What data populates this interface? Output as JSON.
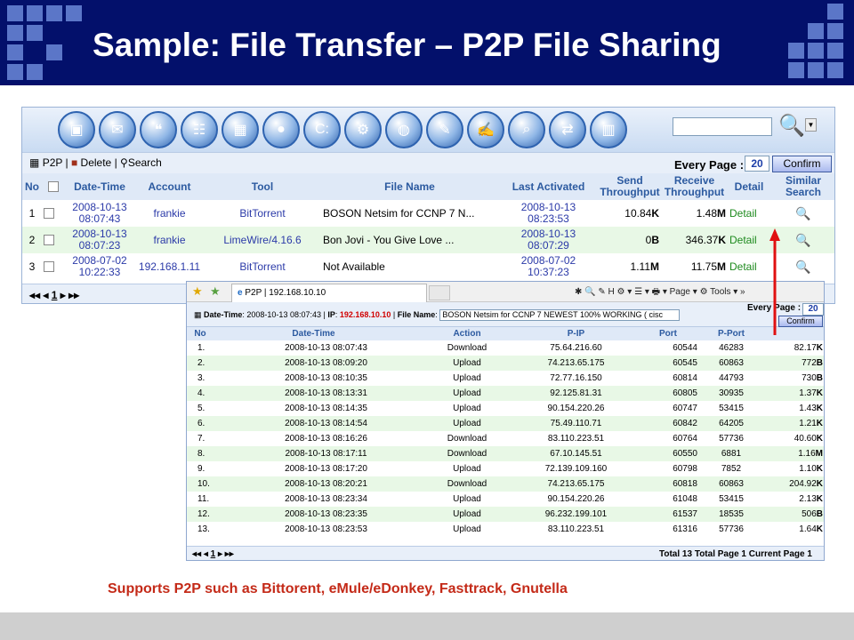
{
  "slide": {
    "title": "Sample: File Transfer – P2P File Sharing",
    "caption": "Supports P2P such as Bittorent, eMule/eDonkey, Fasttrack, Gnutella",
    "colors": {
      "header_bg": "#03106b",
      "caption": "#c42a18",
      "arrow": "#e01010"
    }
  },
  "main": {
    "toolbar_icons": [
      "server-icon",
      "mail-icon",
      "chat-icon",
      "web-icon",
      "box-icon",
      "p2p-icon",
      "terminal-icon",
      "gear-icon",
      "globe-icon",
      "tools-icon",
      "notes-icon",
      "search-folder-icon",
      "transfer-icon",
      "chart-icon"
    ],
    "actions": {
      "p2p": "P2P",
      "delete": "Delete",
      "search": "Search"
    },
    "every_page_label": "Every Page :",
    "every_page_value": "20",
    "confirm": "Confirm",
    "columns": [
      "No",
      "Date-Time",
      "Account",
      "Tool",
      "File Name",
      "Last Activated",
      "Send Throughput",
      "Receive Throughput",
      "Detail",
      "Similar Search"
    ],
    "rows": [
      {
        "no": "1",
        "date": "2008-10-13",
        "time": "08:07:43",
        "account": "frankie",
        "tool": "BitTorrent",
        "file": "BOSON Netsim for CCNP 7 N...",
        "last_date": "2008-10-13",
        "last_time": "08:23:53",
        "send_val": "10.84",
        "send_unit": "K",
        "recv_val": "1.48",
        "recv_unit": "M",
        "detail": "Detail"
      },
      {
        "no": "2",
        "date": "2008-10-13",
        "time": "08:07:23",
        "account": "frankie",
        "tool": "LimeWire/4.16.6",
        "file": "Bon Jovi - You Give Love ...",
        "last_date": "2008-10-13",
        "last_time": "08:07:29",
        "send_val": "0",
        "send_unit": "B",
        "recv_val": "346.37",
        "recv_unit": "K",
        "detail": "Detail"
      },
      {
        "no": "3",
        "date": "2008-07-02",
        "time": "10:22:33",
        "account": "192.168.1.11",
        "tool": "BitTorrent",
        "file": "Not Available",
        "last_date": "2008-07-02",
        "last_time": "10:37:23",
        "send_val": "1.11",
        "send_unit": "M",
        "recv_val": "11.75",
        "recv_unit": "M",
        "detail": "Detail"
      }
    ],
    "pager": "◂◂ ◂ 1 ▸ ▸▸",
    "pager_page": "1"
  },
  "detail": {
    "tab_title": "P2P | 192.168.10.10",
    "browser_tools": "✱ 🔍 ✎ H ⚙ ▾ ☰ ▾ 🖶 ▾ Page ▾ ⚙ Tools ▾ »",
    "datetime_label": "Date-Time",
    "datetime_value": "2008-10-13 08:07:43",
    "ip_label": "IP",
    "ip_value": "192.168.10.10",
    "filename_label": "File Name",
    "filename_value": "BOSON Netsim for CCNP 7 NEWEST 100% WORKING ( cisc",
    "every_page_label": "Every Page :",
    "every_page_value": "20",
    "confirm": "Confirm",
    "columns": [
      "No",
      "Date-Time",
      "Action",
      "P-IP",
      "Port",
      "P-Port",
      ""
    ],
    "rows": [
      [
        "1.",
        "2008-10-13 08:07:43",
        "Download",
        "75.64.216.60",
        "60544",
        "46283",
        "82.17",
        "K"
      ],
      [
        "2.",
        "2008-10-13 08:09:20",
        "Upload",
        "74.213.65.175",
        "60545",
        "60863",
        "772",
        "B"
      ],
      [
        "3.",
        "2008-10-13 08:10:35",
        "Upload",
        "72.77.16.150",
        "60814",
        "44793",
        "730",
        "B"
      ],
      [
        "4.",
        "2008-10-13 08:13:31",
        "Upload",
        "92.125.81.31",
        "60805",
        "30935",
        "1.37",
        "K"
      ],
      [
        "5.",
        "2008-10-13 08:14:35",
        "Upload",
        "90.154.220.26",
        "60747",
        "53415",
        "1.43",
        "K"
      ],
      [
        "6.",
        "2008-10-13 08:14:54",
        "Upload",
        "75.49.110.71",
        "60842",
        "64205",
        "1.21",
        "K"
      ],
      [
        "7.",
        "2008-10-13 08:16:26",
        "Download",
        "83.110.223.51",
        "60764",
        "57736",
        "40.60",
        "K"
      ],
      [
        "8.",
        "2008-10-13 08:17:11",
        "Download",
        "67.10.145.51",
        "60550",
        "6881",
        "1.16",
        "M"
      ],
      [
        "9.",
        "2008-10-13 08:17:20",
        "Upload",
        "72.139.109.160",
        "60798",
        "7852",
        "1.10",
        "K"
      ],
      [
        "10.",
        "2008-10-13 08:20:21",
        "Download",
        "74.213.65.175",
        "60818",
        "60863",
        "204.92",
        "K"
      ],
      [
        "11.",
        "2008-10-13 08:23:34",
        "Upload",
        "90.154.220.26",
        "61048",
        "53415",
        "2.13",
        "K"
      ],
      [
        "12.",
        "2008-10-13 08:23:35",
        "Upload",
        "96.232.199.101",
        "61537",
        "18535",
        "506",
        "B"
      ],
      [
        "13.",
        "2008-10-13 08:23:53",
        "Upload",
        "83.110.223.51",
        "61316",
        "57736",
        "1.64",
        "K"
      ]
    ],
    "pager": "◂◂ ◂ 1 ▸ ▸▸",
    "total": "Total 13  Total Page 1  Current Page 1"
  }
}
